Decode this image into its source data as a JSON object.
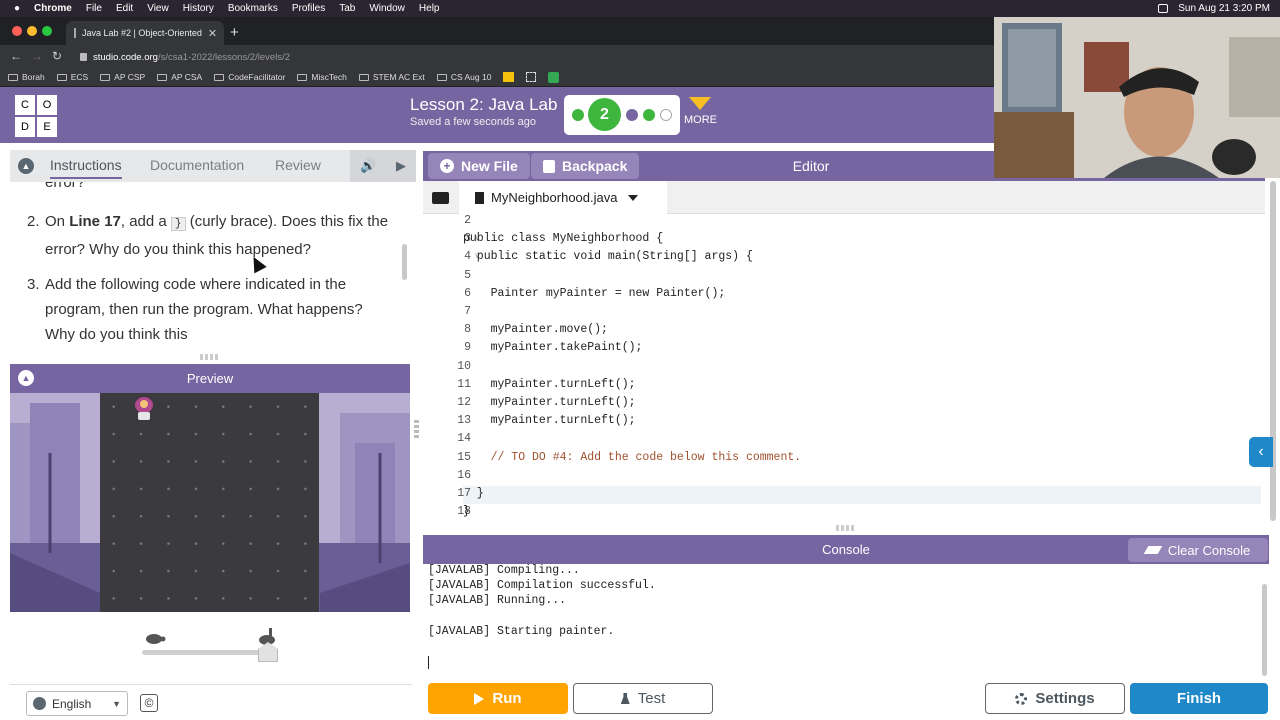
{
  "menubar": {
    "apple": "",
    "items": [
      "Chrome",
      "File",
      "Edit",
      "View",
      "History",
      "Bookmarks",
      "Profiles",
      "Tab",
      "Window",
      "Help"
    ],
    "datetime": "Sun Aug 21  3:20 PM"
  },
  "browser": {
    "tab_title": "Java Lab #2 | Object-Oriented",
    "url_host": "studio.code.org",
    "url_path": "/s/csa1-2022/lessons/2/levels/2",
    "bookmarks": [
      "Borah",
      "ECS",
      "AP CSP",
      "AP CSA",
      "CodeFacilitator",
      "MiscTech",
      "STEM AC Ext",
      "CS Aug 10"
    ]
  },
  "header": {
    "logo_letters": [
      "C",
      "O",
      "D",
      "E"
    ],
    "lesson_title": "Lesson 2: Java Lab",
    "saved_status": "Saved a few seconds ago",
    "current_level": "2",
    "more_label": "MORE",
    "colors": {
      "brand": "#7665a0",
      "complete": "#3eb63e",
      "attempted": "#7665a0",
      "more_arrow": "#fbbf24"
    }
  },
  "instructions": {
    "tabs": [
      "Instructions",
      "Documentation",
      "Review"
    ],
    "fragment": "error?",
    "steps": [
      {
        "num": "2.",
        "pre": "On ",
        "bold": "Line 17",
        "mid": ", add a ",
        "code": "}",
        "post": " (curly brace). Does this fix the error? Why do you think this happened?"
      },
      {
        "num": "3.",
        "text": "Add the following code where indicated in the program, then run the program. What happens? Why do you think this"
      }
    ]
  },
  "preview": {
    "title": "Preview"
  },
  "footer": {
    "language": "English",
    "copyright": "©"
  },
  "editor": {
    "new_file_label": "New File",
    "backpack_label": "Backpack",
    "title": "Editor",
    "filename": "MyNeighborhood.java",
    "lines": [
      {
        "n": "2",
        "text": ""
      },
      {
        "n": "3",
        "text": "public class MyNeighborhood {"
      },
      {
        "n": "4",
        "text": "  public static void main(String[] args) {"
      },
      {
        "n": "5",
        "text": ""
      },
      {
        "n": "6",
        "text": "    Painter myPainter = new Painter();"
      },
      {
        "n": "7",
        "text": ""
      },
      {
        "n": "8",
        "text": "    myPainter.move();"
      },
      {
        "n": "9",
        "text": "    myPainter.takePaint();"
      },
      {
        "n": "10",
        "text": ""
      },
      {
        "n": "11",
        "text": "    myPainter.turnLeft();"
      },
      {
        "n": "12",
        "text": "    myPainter.turnLeft();"
      },
      {
        "n": "13",
        "text": "    myPainter.turnLeft();"
      },
      {
        "n": "14",
        "text": ""
      },
      {
        "n": "15",
        "text": "    // TO DO #4: Add the code below this comment."
      },
      {
        "n": "16",
        "text": ""
      },
      {
        "n": "17",
        "text": "  }"
      },
      {
        "n": "18",
        "text": "}"
      }
    ]
  },
  "console": {
    "title": "Console",
    "clear_label": "Clear Console",
    "lines": [
      "[JAVALAB] Compiling...",
      "[JAVALAB] Compilation successful.",
      "[JAVALAB] Running...",
      "",
      "[JAVALAB] Starting painter."
    ]
  },
  "actions": {
    "run_label": "Run",
    "test_label": "Test",
    "settings_label": "Settings",
    "finish_label": "Finish"
  }
}
